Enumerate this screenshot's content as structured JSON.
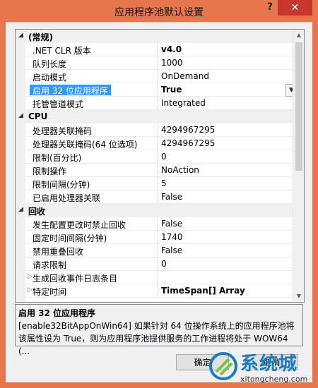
{
  "window": {
    "title": "应用程序池默认设置",
    "help": "?",
    "close": "✕"
  },
  "grid": {
    "rows": [
      {
        "kind": "cat",
        "name": "(常规)"
      },
      {
        "kind": "prop",
        "name": ".NET CLR 版本",
        "value": "v4.0",
        "bold": true
      },
      {
        "kind": "prop",
        "name": "队列长度",
        "value": "1000"
      },
      {
        "kind": "prop",
        "name": "启动模式",
        "value": "OnDemand"
      },
      {
        "kind": "prop",
        "name": "启用 32 位应用程序",
        "value": "True",
        "selected": true
      },
      {
        "kind": "prop",
        "name": "托管管道模式",
        "value": "Integrated"
      },
      {
        "kind": "cat",
        "name": "CPU"
      },
      {
        "kind": "prop",
        "name": "处理器关联掩码",
        "value": "4294967295"
      },
      {
        "kind": "prop",
        "name": "处理器关联掩码(64 位选项)",
        "value": "4294967295"
      },
      {
        "kind": "prop",
        "name": "限制(百分比)",
        "value": "0"
      },
      {
        "kind": "prop",
        "name": "限制操作",
        "value": "NoAction"
      },
      {
        "kind": "prop",
        "name": "限制间隔(分钟)",
        "value": "5"
      },
      {
        "kind": "prop",
        "name": "已启用处理器关联",
        "value": "False"
      },
      {
        "kind": "cat",
        "name": "回收"
      },
      {
        "kind": "prop",
        "name": "发生配置更改时禁止回收",
        "value": "False"
      },
      {
        "kind": "prop",
        "name": "固定时间间隔(分钟)",
        "value": "1740"
      },
      {
        "kind": "prop",
        "name": "禁用重叠回收",
        "value": "False"
      },
      {
        "kind": "prop",
        "name": "请求限制",
        "value": "0"
      },
      {
        "kind": "exp",
        "name": "生成回收事件日志条目",
        "value": ""
      },
      {
        "kind": "exp",
        "name": "特定时间",
        "value": "TimeSpan[] Array",
        "bold": true
      }
    ],
    "cat_arrow": "◢",
    "exp_arrow": "▷",
    "dropdown_arrow": "▼",
    "scroll_up": "▲",
    "scroll_down": "▼"
  },
  "description": {
    "title": "启用 32 位应用程序",
    "text": "[enable32BitAppOnWin64] 如果针对 64 位操作系统上的应用程序池将该属性设为 True，则为应用程序池提供服务的工作进程将处于 WOW64 (..."
  },
  "buttons": {
    "ok": "确定",
    "cancel": "取消"
  },
  "watermark": {
    "text": "系统城",
    "url": "xitongcheng.com"
  },
  "colors": {
    "frame": "#e8764c",
    "selection": "#3399ff",
    "close": "#c7372c"
  }
}
